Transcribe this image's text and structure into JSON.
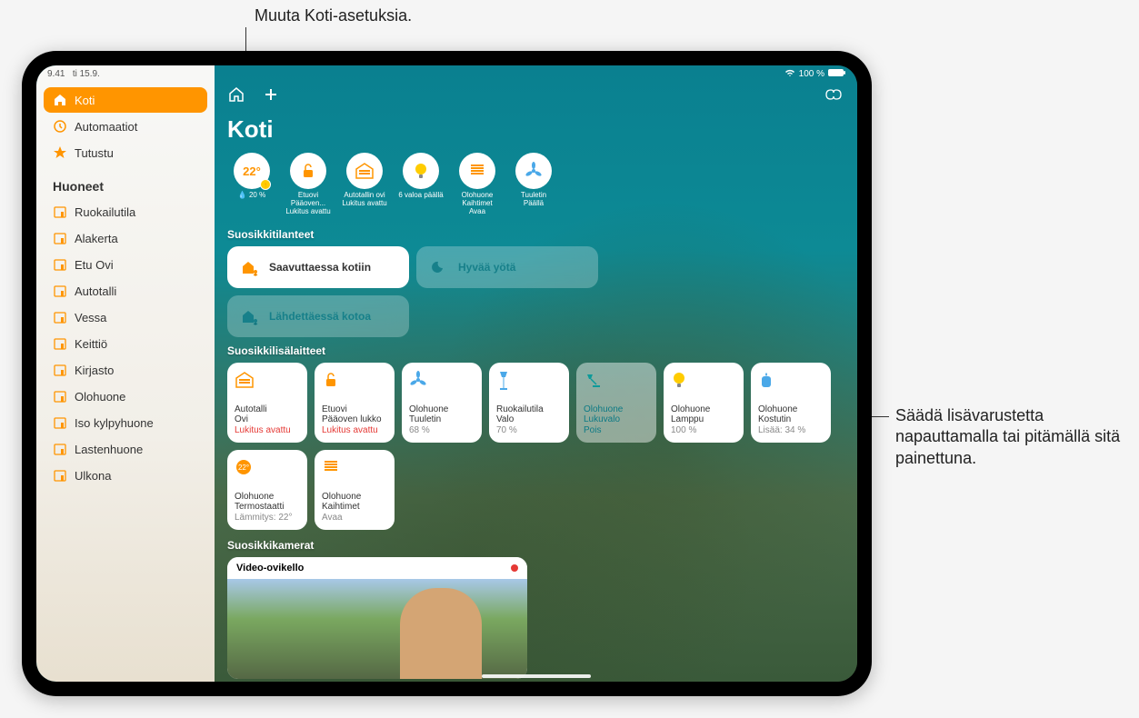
{
  "callouts": {
    "top": "Muuta Koti-asetuksia.",
    "right": "Säädä lisävarustetta napauttamalla tai pitämällä sitä painettuna."
  },
  "statusbar": {
    "time": "9.41",
    "date": "ti 15.9.",
    "battery": "100 %"
  },
  "sidebar": {
    "main": [
      {
        "label": "Koti",
        "icon": "home"
      },
      {
        "label": "Automaatiot",
        "icon": "clock"
      },
      {
        "label": "Tutustu",
        "icon": "star"
      }
    ],
    "rooms_heading": "Huoneet",
    "rooms": [
      "Ruokailutila",
      "Alakerta",
      "Etu Ovi",
      "Autotalli",
      "Vessa",
      "Keittiö",
      "Kirjasto",
      "Olohuone",
      "Iso kylpyhuone",
      "Lastenhuone",
      "Ulkona"
    ]
  },
  "header": {
    "title": "Koti"
  },
  "pills": [
    {
      "main": "22°",
      "sub": "20 %",
      "line1": "",
      "line2": ""
    },
    {
      "icon": "lock-open",
      "line1": "Etuovi Pääoven...",
      "line2": "Lukitus avattu"
    },
    {
      "icon": "garage",
      "line1": "Autotallin ovi",
      "line2": "Lukitus avattu"
    },
    {
      "icon": "bulb",
      "line1": "6 valoa päällä",
      "line2": ""
    },
    {
      "icon": "blinds",
      "line1": "Olohuone Kaihtimet",
      "line2": "Avaa"
    },
    {
      "icon": "fan",
      "line1": "Tuuletin",
      "line2": "Päällä"
    }
  ],
  "sections": {
    "scenes": "Suosikkitilanteet",
    "accessories": "Suosikkilisälaitteet",
    "cameras": "Suosikkikamerat"
  },
  "scenes": [
    {
      "label": "Saavuttaessa kotiin",
      "style": "white",
      "color": "#ff9500"
    },
    {
      "label": "Hyvää yötä",
      "style": "glass",
      "color": "#17808a"
    },
    {
      "label": "Lähdettäessä kotoa",
      "style": "glass",
      "color": "#17808a"
    }
  ],
  "accessories": [
    {
      "room": "Autotalli",
      "name": "Ovi",
      "status": "Lukitus avattu",
      "statusClass": "alert",
      "icon": "garage",
      "iconColor": "#ff9500"
    },
    {
      "room": "Etuovi",
      "name": "Pääoven lukko",
      "status": "Lukitus avattu",
      "statusClass": "alert",
      "icon": "lock-open",
      "iconColor": "#ff9500"
    },
    {
      "room": "Olohuone",
      "name": "Tuuletin",
      "status": "68 %",
      "statusClass": "",
      "icon": "fan",
      "iconColor": "#4aa8e8"
    },
    {
      "room": "Ruokailutila",
      "name": "Valo",
      "status": "70 %",
      "statusClass": "",
      "icon": "lamp-floor",
      "iconColor": "#4aa8e8"
    },
    {
      "room": "Olohuone",
      "name": "Lukuvalo",
      "status": "Pois",
      "statusClass": "green",
      "icon": "lamp-desk",
      "iconColor": "#0d9a9a",
      "off": true
    },
    {
      "room": "Olohuone",
      "name": "Lamppu",
      "status": "100 %",
      "statusClass": "",
      "icon": "bulb",
      "iconColor": "#ffcc00"
    },
    {
      "room": "Olohuone",
      "name": "Kostutin",
      "status": "Lisää: 34 %",
      "statusClass": "",
      "icon": "humidifier",
      "iconColor": "#4aa8e8"
    },
    {
      "room": "Olohuone",
      "name": "Termostaatti",
      "status": "Lämmitys: 22°",
      "statusClass": "",
      "icon": "thermostat",
      "iconColor": "#ff9500"
    },
    {
      "room": "Olohuone",
      "name": "Kaihtimet",
      "status": "Avaa",
      "statusClass": "",
      "icon": "blinds",
      "iconColor": "#8aa8c8"
    }
  ],
  "camera": {
    "label": "Video-ovikello"
  }
}
